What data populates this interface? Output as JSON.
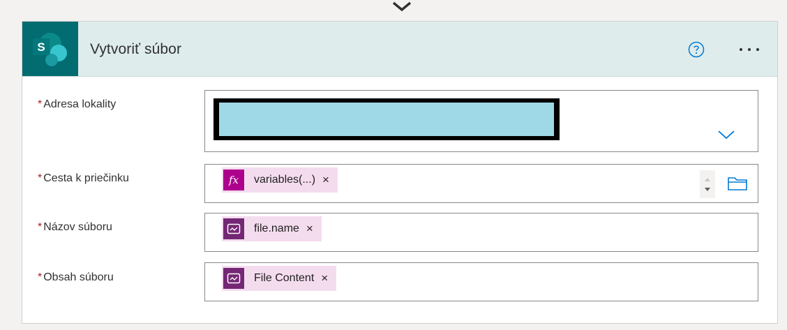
{
  "action": {
    "title": "Vytvoriť súbor",
    "app_logo_letter": "S"
  },
  "colors": {
    "sharepoint_teal": "#036c70",
    "header_bg": "#deecec",
    "required_asterisk": "#a4262c",
    "token_bg": "#f4dcef",
    "fx_icon_bg": "#ad008c",
    "pa_icon_bg": "#742774",
    "accent_blue": "#0078d4",
    "redaction_fill": "#9fd9e8"
  },
  "fields": {
    "site_address": {
      "required": "*",
      "label": "Adresa lokality"
    },
    "folder_path": {
      "required": "*",
      "label": "Cesta k priečinku",
      "token_label": "variables(...)",
      "token_remove": "×",
      "token_icon": "fx-icon"
    },
    "file_name": {
      "required": "*",
      "label": "Názov súboru",
      "token_label": "file.name",
      "token_remove": "×",
      "token_icon": "power-automate-icon"
    },
    "file_content": {
      "required": "*",
      "label": "Obsah súboru",
      "token_label": "File Content",
      "token_remove": "×",
      "token_icon": "power-automate-icon"
    }
  }
}
